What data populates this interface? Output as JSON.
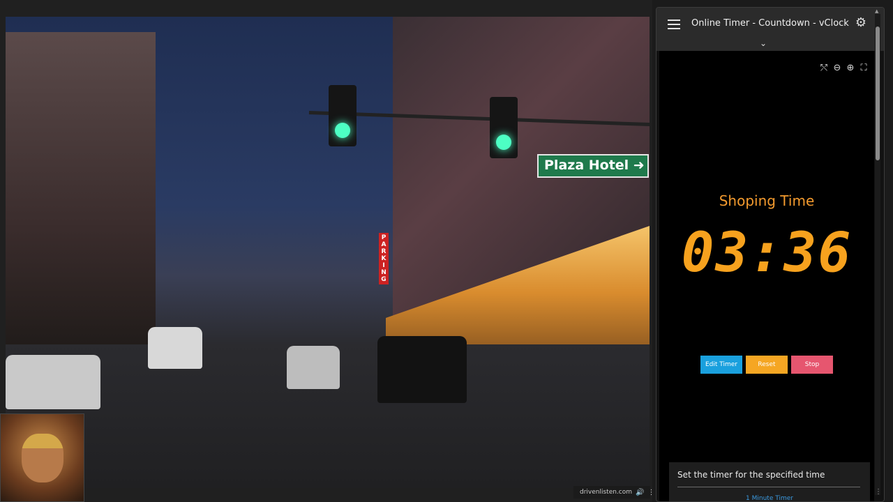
{
  "video": {
    "street_sign": "Plaza Hotel ➜",
    "parking_sign": "PARKING",
    "bar": {
      "url": "drivenlisten.com",
      "volume_icon": "speaker-icon",
      "more_icon": "kebab-icon"
    }
  },
  "panel": {
    "title": "Online Timer - Countdown - vClock",
    "menu_icon": "hamburger-icon",
    "settings_icon": "gear-icon",
    "expand_icon": "chevron-down-icon",
    "tools": [
      {
        "name": "share-icon",
        "glyph": "⤲"
      },
      {
        "name": "zoom-out-icon",
        "glyph": "⊖"
      },
      {
        "name": "zoom-in-icon",
        "glyph": "⊕"
      },
      {
        "name": "fullscreen-icon",
        "glyph": "⛶"
      }
    ],
    "timer": {
      "name": "Shoping Time",
      "display": "03:36",
      "buttons": {
        "edit": "Edit Timer",
        "reset": "Reset",
        "stop": "Stop"
      }
    },
    "info": {
      "title": "Set the timer for the specified time",
      "link": "1 Minute Timer"
    }
  },
  "colors": {
    "timer_orange": "#f7a21e",
    "edit_blue": "#1aa0de",
    "reset_orange": "#f5a623",
    "stop_red": "#e6566f",
    "link_blue": "#3b9ae0"
  }
}
